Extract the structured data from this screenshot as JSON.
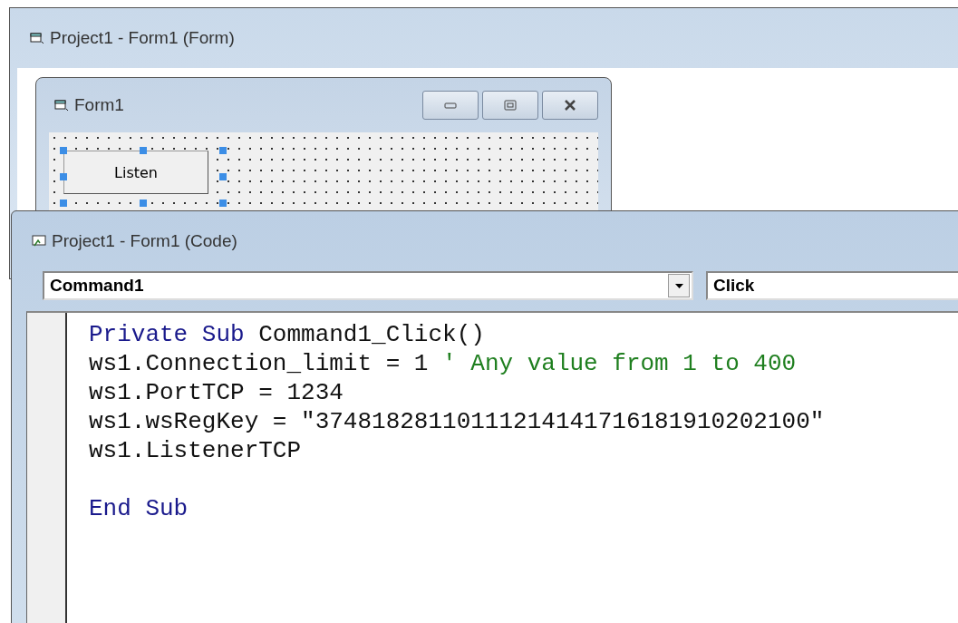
{
  "form_window": {
    "title": "Project1 - Form1 (Form)",
    "form": {
      "title": "Form1",
      "button": {
        "label": "Listen",
        "selected": true
      }
    }
  },
  "code_window": {
    "title": "Project1 - Form1 (Code)",
    "object_combo": {
      "value": "Command1"
    },
    "procedure_combo": {
      "value": "Click"
    },
    "lines": [
      {
        "kind": "code",
        "tokens": [
          {
            "kind": "keyword",
            "text": "Private Sub"
          },
          {
            "kind": "plain",
            "text": " Command1_Click()"
          }
        ]
      },
      {
        "kind": "code",
        "tokens": [
          {
            "kind": "plain",
            "text": "ws1.Connection_limit = 1 "
          },
          {
            "kind": "comment",
            "text": "' Any value from 1 to 400"
          }
        ]
      },
      {
        "kind": "code",
        "tokens": [
          {
            "kind": "plain",
            "text": "ws1.PortTCP = 1234"
          }
        ]
      },
      {
        "kind": "code",
        "tokens": [
          {
            "kind": "plain",
            "text": "ws1.wsRegKey = \"37481828110111214141716181910202100\""
          }
        ]
      },
      {
        "kind": "code",
        "tokens": [
          {
            "kind": "plain",
            "text": "ws1.ListenerTCP"
          }
        ]
      },
      {
        "kind": "blank"
      },
      {
        "kind": "code",
        "tokens": [
          {
            "kind": "keyword",
            "text": "End Sub"
          }
        ]
      }
    ]
  }
}
